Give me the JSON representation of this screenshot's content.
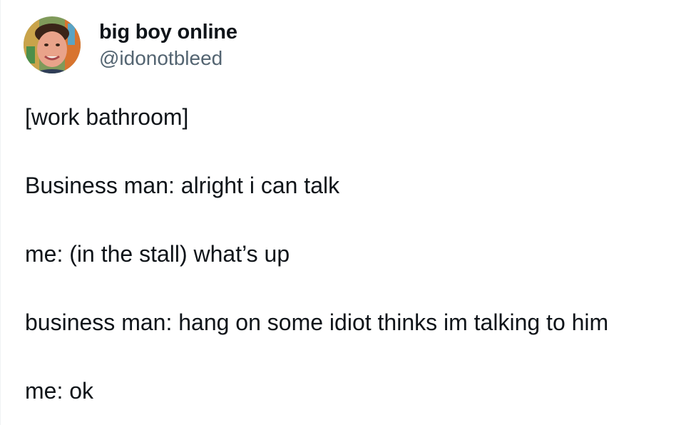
{
  "tweet": {
    "author": {
      "display_name": "big boy online",
      "handle": "@idonotbleed",
      "avatar_icon": "profile-photo-avatar"
    },
    "lines": [
      "[work bathroom]",
      "Business man: alright i can talk",
      "me: (in the stall) what’s up",
      "business man: hang on some idiot thinks im talking to him",
      "me: ok"
    ]
  },
  "colors": {
    "text_primary": "#0f1419",
    "text_secondary": "#536471",
    "background": "#ffffff"
  }
}
